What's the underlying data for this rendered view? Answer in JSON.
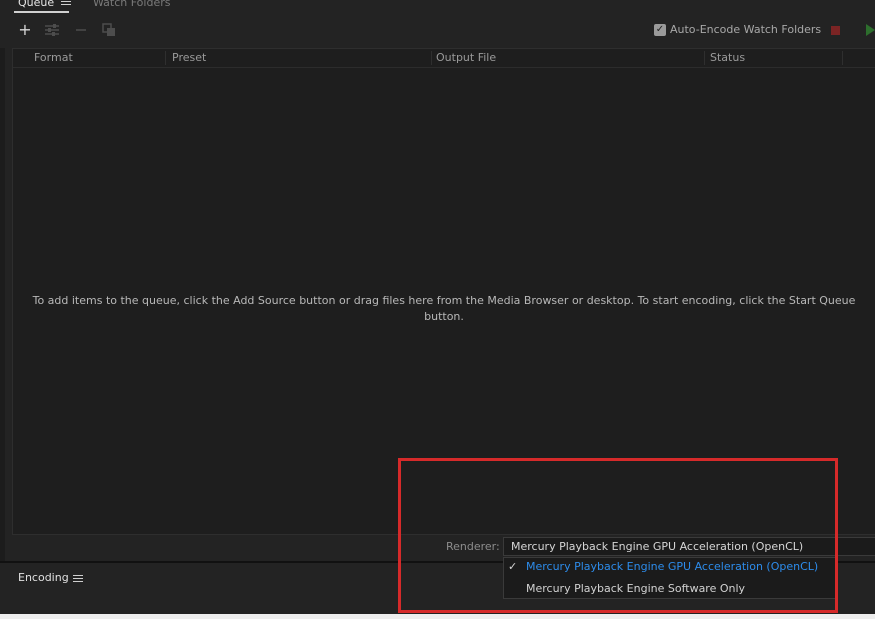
{
  "tabs": [
    {
      "label": "Queue",
      "active": true
    },
    {
      "label": "Watch Folders",
      "active": false
    }
  ],
  "toolbar": {
    "add_icon": "plus-icon",
    "settings_icon": "sliders-icon",
    "remove_icon": "minus-icon",
    "duplicate_icon": "duplicate-icon",
    "auto_encode_label": "Auto-Encode Watch Folders",
    "auto_encode_checked": true
  },
  "queue": {
    "columns": [
      "Format",
      "Preset",
      "Output File",
      "Status"
    ],
    "empty_message": "To add items to the queue, click the Add Source button or drag files here from the Media Browser or desktop.  To start encoding, click the Start Queue button."
  },
  "renderer": {
    "label": "Renderer:",
    "selected": "Mercury Playback Engine GPU Acceleration (OpenCL)",
    "options": [
      {
        "label": "Mercury Playback Engine GPU Acceleration (OpenCL)",
        "selected": true
      },
      {
        "label": "Mercury Playback Engine Software Only",
        "selected": false
      }
    ]
  },
  "encoding": {
    "title": "Encoding"
  },
  "colors": {
    "highlight": "#d62a2a",
    "selected_text": "#2d8ceb",
    "stop": "#7b2424",
    "start": "#2d6e2d"
  }
}
